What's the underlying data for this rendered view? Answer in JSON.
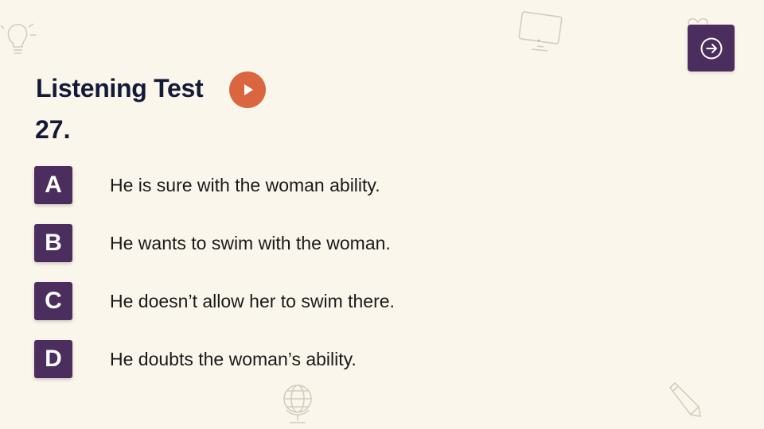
{
  "header": {
    "title": "Listening Test",
    "question_number": "27."
  },
  "options": [
    {
      "letter": "A",
      "text": "He is sure with the woman ability."
    },
    {
      "letter": "B",
      "text": "He wants to swim with the woman."
    },
    {
      "letter": "C",
      "text": "He doesn’t allow her to swim there."
    },
    {
      "letter": "D",
      "text": "He doubts the woman’s ability."
    }
  ],
  "icons": {
    "play": "play-icon",
    "next": "arrow-right-circle-icon"
  },
  "colors": {
    "background": "#fbf6ec",
    "accent_purple": "#4b2d5e",
    "play_orange": "#d9663f",
    "title_navy": "#131a38"
  }
}
